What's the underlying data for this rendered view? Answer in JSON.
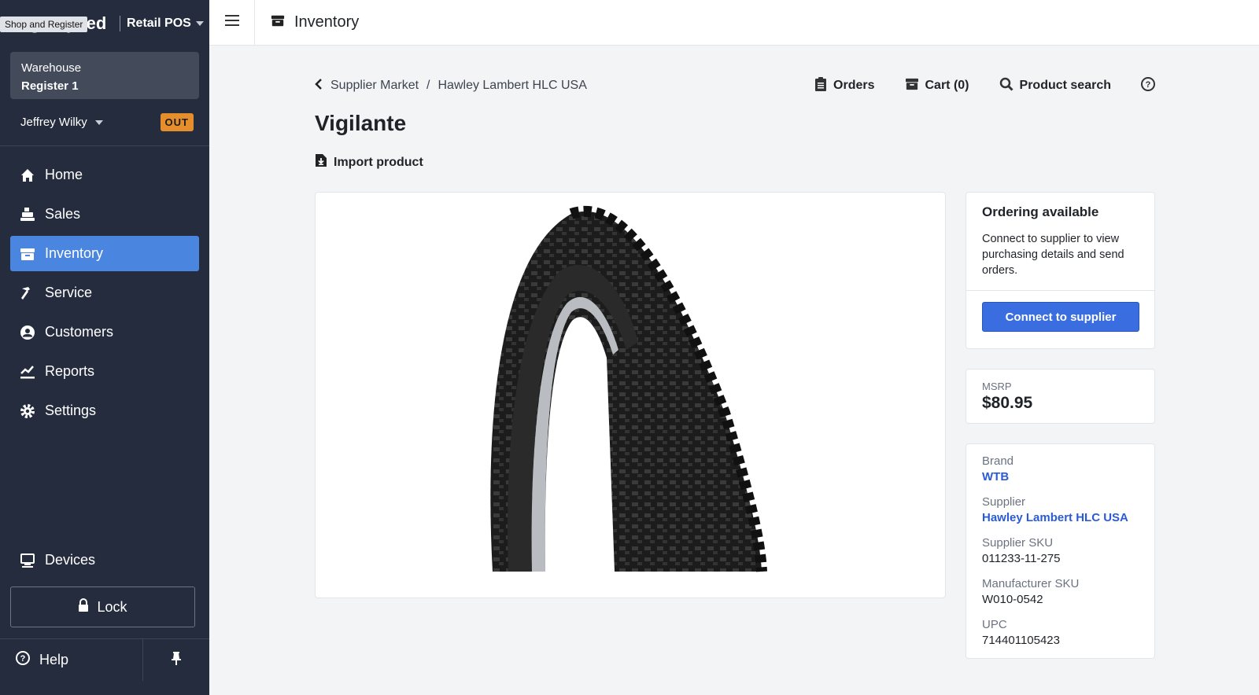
{
  "brand": {
    "logo_text": "Lightspeed",
    "product": "Retail POS",
    "tooltip": "Shop and Register"
  },
  "register": {
    "location": "Warehouse",
    "name": "Register 1"
  },
  "user": {
    "name": "Jeffrey Wilky",
    "status": "OUT"
  },
  "nav": {
    "items": [
      {
        "label": "Home",
        "icon": "home-icon"
      },
      {
        "label": "Sales",
        "icon": "register-icon"
      },
      {
        "label": "Inventory",
        "icon": "inventory-box-icon",
        "active": true
      },
      {
        "label": "Service",
        "icon": "hammer-icon"
      },
      {
        "label": "Customers",
        "icon": "person-icon"
      },
      {
        "label": "Reports",
        "icon": "chart-icon"
      },
      {
        "label": "Settings",
        "icon": "gear-icon"
      }
    ],
    "devices": "Devices",
    "lock": "Lock",
    "help": "Help"
  },
  "topbar": {
    "title": "Inventory"
  },
  "breadcrumb": {
    "root": "Supplier Market",
    "separator": "/",
    "current": "Hawley Lambert HLC USA"
  },
  "actions": {
    "orders": "Orders",
    "cart": "Cart (0)",
    "search": "Product search"
  },
  "product": {
    "title": "Vigilante",
    "import_label": "Import product",
    "image_alt": "Bicycle tire"
  },
  "ordering": {
    "title": "Ordering available",
    "body": "Connect to supplier to view purchasing details and send orders.",
    "button": "Connect to supplier"
  },
  "msrp": {
    "label": "MSRP",
    "value": "$80.95"
  },
  "details": {
    "brand_label": "Brand",
    "brand_value": "WTB",
    "supplier_label": "Supplier",
    "supplier_value": "Hawley Lambert HLC USA",
    "supplier_sku_label": "Supplier SKU",
    "supplier_sku_value": "011233-11-275",
    "mfr_sku_label": "Manufacturer SKU",
    "mfr_sku_value": "W010-0542",
    "upc_label": "UPC",
    "upc_value": "714401105423"
  },
  "colors": {
    "sidebar": "#242c3e",
    "active_nav": "#4a86e0",
    "primary_button": "#3a6ee0",
    "link": "#2a5bd7",
    "out_badge": "#e58e2b"
  }
}
